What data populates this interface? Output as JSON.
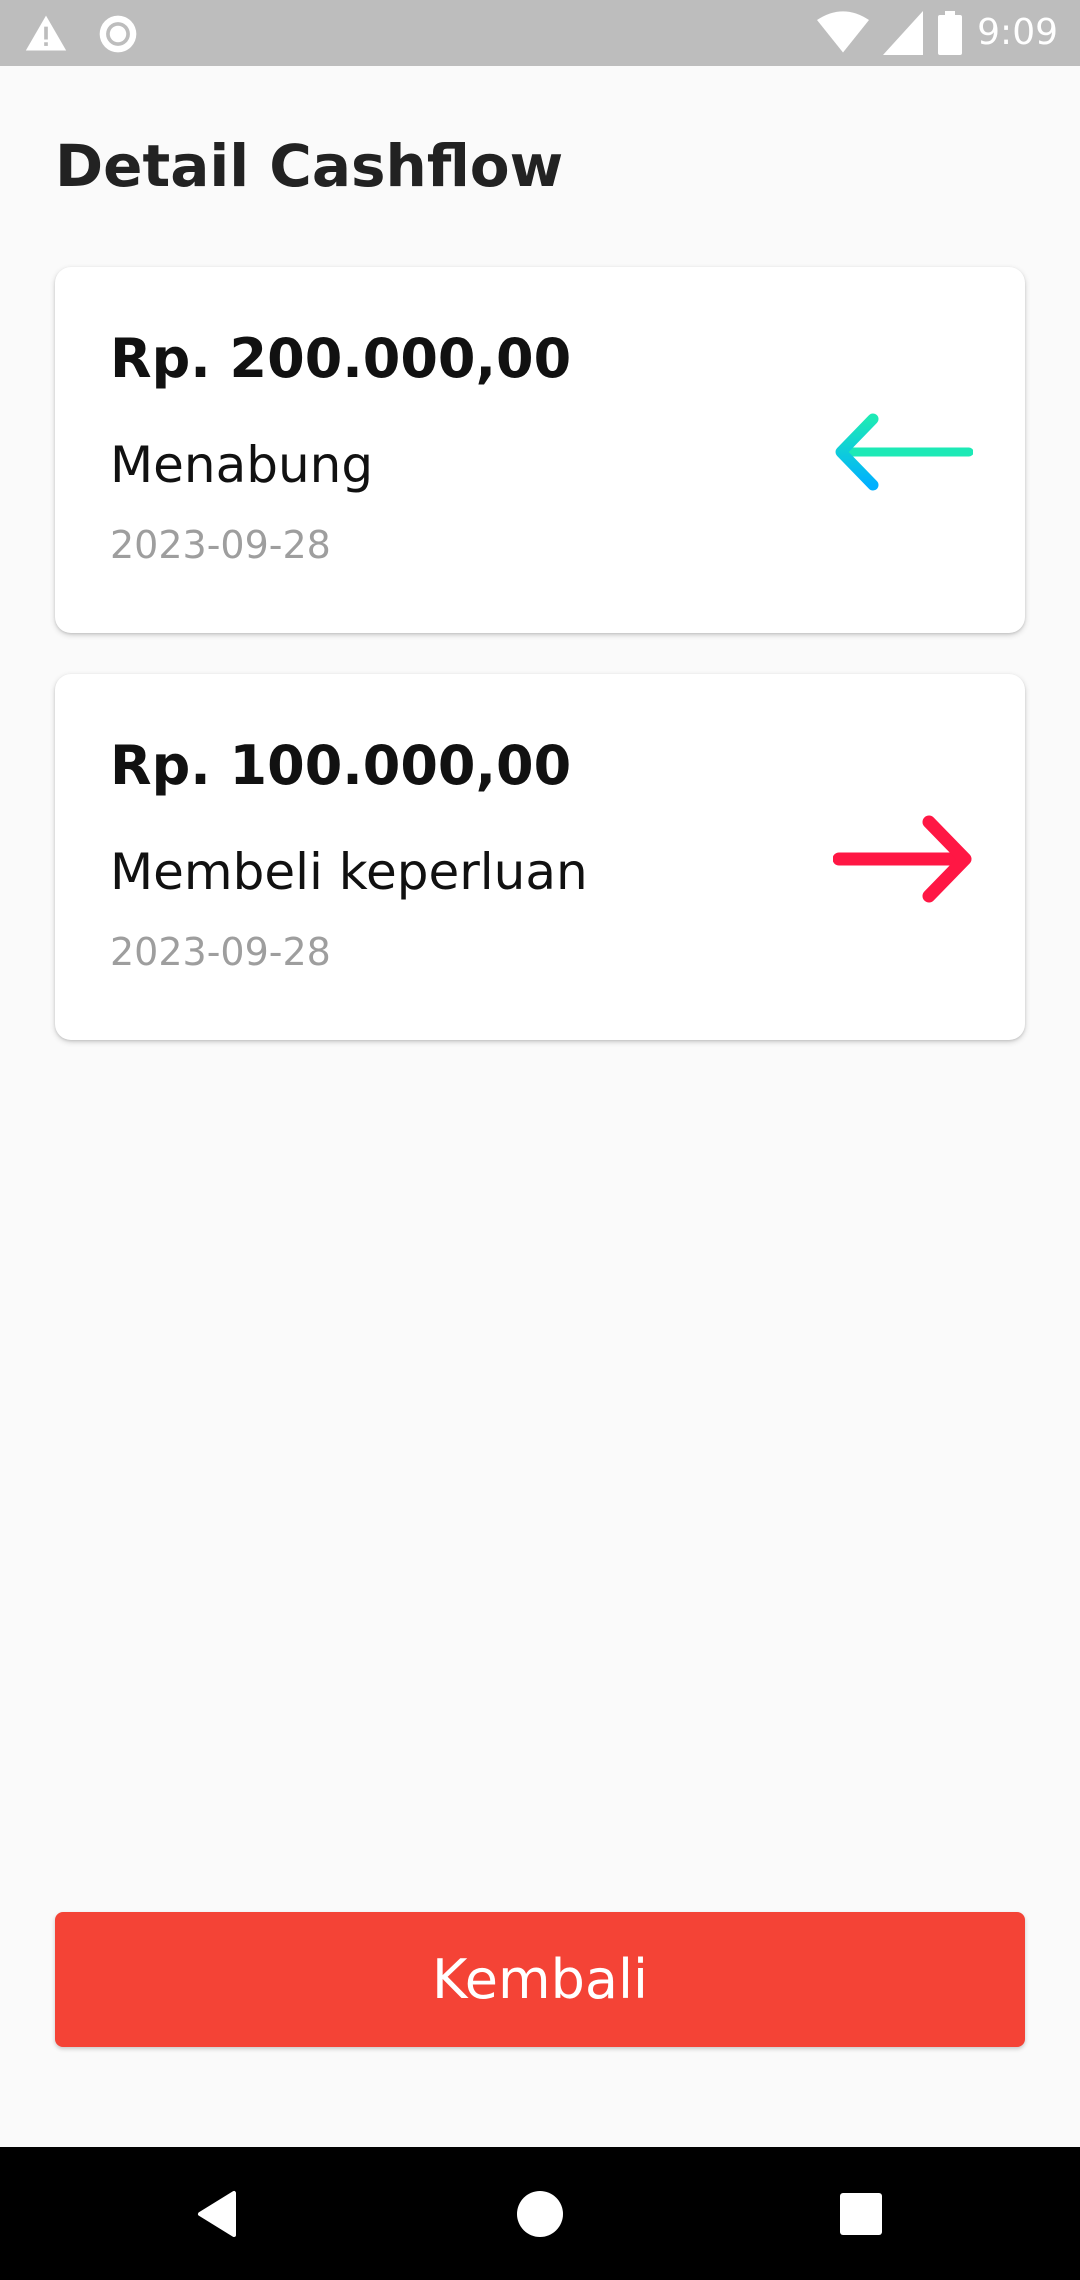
{
  "status_bar": {
    "time": "9:09",
    "icons": [
      "alert-icon",
      "sync-icon",
      "wifi-icon",
      "signal-icon",
      "battery-icon"
    ]
  },
  "page": {
    "title": "Detail Cashflow"
  },
  "transactions": [
    {
      "amount": "Rp. 200.000,00",
      "description": "Menabung",
      "date": "2023-09-28",
      "direction_icon": "arrow-left-icon",
      "icon_colors": [
        "#1de9b6",
        "#00b0ff"
      ]
    },
    {
      "amount": "Rp. 100.000,00",
      "description": "Membeli keperluan",
      "date": "2023-09-28",
      "direction_icon": "arrow-right-icon",
      "icon_colors": [
        "#ff1744",
        "#ff1744"
      ]
    }
  ],
  "footer": {
    "back_button_label": "Kembali",
    "accent_color": "#f44336"
  },
  "nav_bar": {
    "buttons": [
      "back-icon",
      "home-icon",
      "recents-icon"
    ]
  }
}
